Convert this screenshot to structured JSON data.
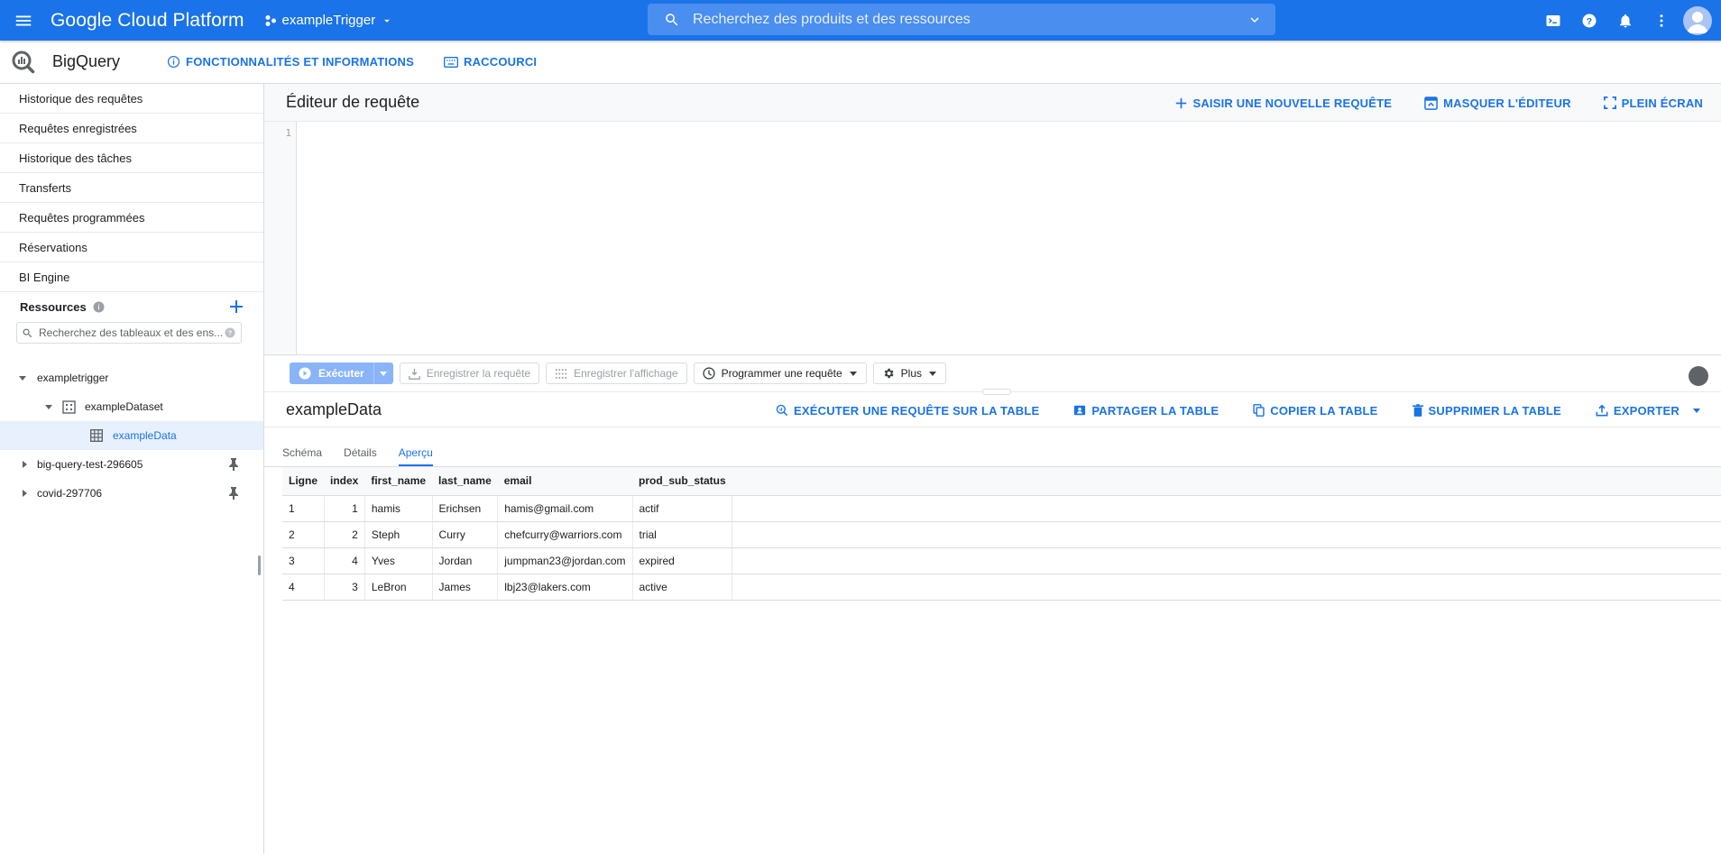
{
  "topbar": {
    "brand": "Google Cloud Platform",
    "project": "exampleTrigger",
    "search_placeholder": "Recherchez des produits et des ressources",
    "icons": [
      "menu-icon",
      "project-icon",
      "search-icon",
      "chevron-down-icon",
      "cloud-shell-icon",
      "help-icon",
      "notifications-icon",
      "more-vert-icon",
      "account-avatar"
    ]
  },
  "productbar": {
    "name": "BigQuery",
    "features": "FONCTIONNALITÉS ET INFORMATIONS",
    "shortcuts": "RACCOURCI"
  },
  "sidebar": {
    "items": [
      {
        "label": "Historique des requêtes"
      },
      {
        "label": "Requêtes enregistrées"
      },
      {
        "label": "Historique des tâches"
      },
      {
        "label": "Transferts"
      },
      {
        "label": "Requêtes programmées"
      },
      {
        "label": "Réservations"
      },
      {
        "label": "BI Engine"
      }
    ],
    "resources_label": "Ressources",
    "search_placeholder": "Recherchez des tableaux et des ens...",
    "tree": {
      "project": "exampletrigger",
      "dataset": "exampleDataset",
      "table": "exampleData",
      "other_projects": [
        "big-query-test-296605",
        "covid-297706"
      ]
    }
  },
  "editor": {
    "title": "Éditeur de requête",
    "new_query": "SAISIR UNE NOUVELLE REQUÊTE",
    "hide_editor": "MASQUER L'ÉDITEUR",
    "fullscreen": "PLEIN ÉCRAN",
    "line_number": "1"
  },
  "toolbar": {
    "run": "Exécuter",
    "save_query": "Enregistrer la requête",
    "save_view": "Enregistrer l'affichage",
    "schedule": "Programmer une requête",
    "more": "Plus"
  },
  "table_panel": {
    "title": "exampleData",
    "query_table": "EXÉCUTER UNE REQUÊTE SUR LA TABLE",
    "share": "PARTAGER LA TABLE",
    "copy": "COPIER LA TABLE",
    "delete": "SUPPRIMER LA TABLE",
    "export": "EXPORTER",
    "tabs": [
      "Schéma",
      "Détails",
      "Aperçu"
    ],
    "active_tab": "Aperçu",
    "columns": [
      "Ligne",
      "index",
      "first_name",
      "last_name",
      "email",
      "prod_sub_status"
    ],
    "rows": [
      [
        "1",
        "1",
        "hamis",
        "Erichsen",
        "hamis@gmail.com",
        "actif"
      ],
      [
        "2",
        "2",
        "Steph",
        "Curry",
        "chefcurry@warriors.com",
        "trial"
      ],
      [
        "3",
        "4",
        "Yves",
        "Jordan",
        "jumpman23@jordan.com",
        "expired"
      ],
      [
        "4",
        "3",
        "LeBron",
        "James",
        "lbj23@lakers.com",
        "active"
      ]
    ]
  },
  "colors": {
    "brand_blue": "#1a73e8",
    "run_button": "#8ab4f8"
  }
}
